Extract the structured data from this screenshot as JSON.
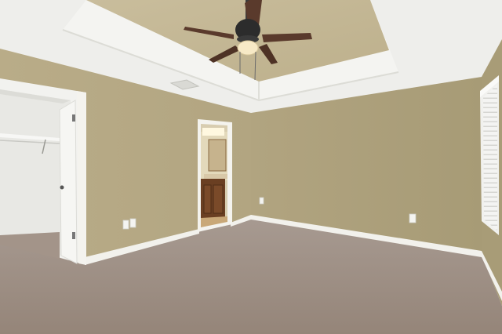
{
  "scene": {
    "type": "photo",
    "subject": "empty bedroom",
    "features": [
      "ceiling-fan",
      "tray-ceiling",
      "closet",
      "bathroom-doorway",
      "window-blinds",
      "carpet"
    ]
  },
  "colors": {
    "wall": "#b5a884",
    "wall_right": "#a99d78",
    "ceiling": "#efefec",
    "tray_inset": "#c4b896",
    "trim": "#f2f1ec",
    "carpet": "#9e8f86",
    "closet": "#e9e8e3",
    "fan_blade": "#5a3a2c",
    "cabinet": "#6a3f22"
  }
}
